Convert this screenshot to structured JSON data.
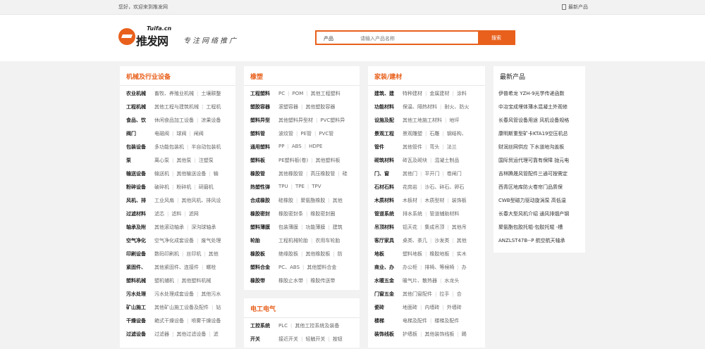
{
  "topbar": {
    "welcome": "您好，欢迎来到推发网",
    "latest": "最新产品"
  },
  "header": {
    "logo_en": "Tuifa.cn",
    "logo_cn": "推发网",
    "slogan": "专注网络推广",
    "search_category": "产品",
    "search_placeholder": "请输入产品名称",
    "search_button": "搜索"
  },
  "panels": [
    {
      "title": "机械及行业设备",
      "rows": [
        {
          "h": "农业机械",
          "s": [
            "畜牧、养殖业机械",
            "土壤耕整"
          ]
        },
        {
          "h": "工程机械",
          "s": [
            "其他工程与建筑机械",
            "工程机"
          ]
        },
        {
          "h": "食品、饮",
          "s": [
            "休闲食品加工设备",
            "凉果设备"
          ]
        },
        {
          "h": "阀门",
          "s": [
            "电磁阀",
            "球阀",
            "闸阀"
          ]
        },
        {
          "h": "包装设备",
          "s": [
            "多功能包装机",
            "半自动包装机"
          ]
        },
        {
          "h": "泵",
          "s": [
            "离心泵",
            "其他泵",
            "注塑泵"
          ]
        },
        {
          "h": "输送设备",
          "s": [
            "输送机",
            "其他输送设备",
            "输"
          ]
        },
        {
          "h": "粉碎设备",
          "s": [
            "破碎机",
            "粉碎机",
            "研磨机"
          ]
        },
        {
          "h": "风机、排",
          "s": [
            "工业风扇",
            "其他风机、排风设"
          ]
        },
        {
          "h": "过滤材料",
          "s": [
            "滤芯",
            "滤料",
            "滤网"
          ]
        },
        {
          "h": "轴承及附",
          "s": [
            "其他滚动轴承",
            "深沟球轴承"
          ]
        },
        {
          "h": "空气净化",
          "s": [
            "空气净化成套设备",
            "废气处理"
          ]
        },
        {
          "h": "印刷设备",
          "s": [
            "数码印刷机",
            "丝印机",
            "其他"
          ]
        },
        {
          "h": "紧固件、",
          "s": [
            "其他紧固件、连接件",
            "螺栓"
          ]
        },
        {
          "h": "塑料机械",
          "s": [
            "塑机辅机",
            "其他塑料机械"
          ]
        },
        {
          "h": "污水处理",
          "s": [
            "污水处理成套设备",
            "其他污水"
          ]
        },
        {
          "h": "矿山施工",
          "s": [
            "其他矿山施工设备及配件",
            "钻"
          ]
        },
        {
          "h": "干燥设备",
          "s": [
            "箱式干燥设备",
            "喷雾干燥设备"
          ]
        },
        {
          "h": "过滤设备",
          "s": [
            "过滤器",
            "其他过滤设备",
            "滤"
          ]
        }
      ]
    },
    {
      "title": "橡塑",
      "rows": [
        {
          "h": "工程塑料",
          "s": [
            "PC",
            "POM",
            "其他工程塑料"
          ]
        },
        {
          "h": "塑胶容器",
          "s": [
            "滚塑容器",
            "其他塑胶容器"
          ]
        },
        {
          "h": "塑料异型",
          "s": [
            "其他塑料异型材",
            "PVC塑料异"
          ]
        },
        {
          "h": "塑料管",
          "s": [
            "波纹管",
            "PE管",
            "PVC管"
          ]
        },
        {
          "h": "通用塑料",
          "s": [
            "PP",
            "ABS",
            "HDPE"
          ]
        },
        {
          "h": "塑料板",
          "s": [
            "PE塑料板(卷)",
            "其他塑料板"
          ]
        },
        {
          "h": "橡胶管",
          "s": [
            "其他橡胶管",
            "高压橡胶管",
            "硅"
          ]
        },
        {
          "h": "热塑性弹",
          "s": [
            "TPU",
            "TPE",
            "TPV"
          ]
        },
        {
          "h": "合成橡胶",
          "s": [
            "硅橡胶",
            "聚氨酯橡胶",
            "其他"
          ]
        },
        {
          "h": "橡胶密封",
          "s": [
            "橡胶密封条",
            "橡胶密封圈"
          ]
        },
        {
          "h": "塑料薄膜",
          "s": [
            "包装薄膜",
            "功能薄膜",
            "建筑"
          ]
        },
        {
          "h": "轮胎",
          "s": [
            "工程机械轮胎",
            "农用车轮胎"
          ]
        },
        {
          "h": "橡胶板",
          "s": [
            "绝缘胶板",
            "其他橡胶板",
            "防"
          ]
        },
        {
          "h": "塑料合金",
          "s": [
            "PC、ABS",
            "其他塑料合金"
          ]
        },
        {
          "h": "橡胶带",
          "s": [
            "橡胶止水带",
            "橡胶传送带"
          ]
        }
      ]
    },
    {
      "title": "电工电气",
      "rows": [
        {
          "h": "工控系统",
          "s": [
            "PLC",
            "其他工控系统及装备"
          ]
        },
        {
          "h": "开关",
          "s": [
            "接近开关",
            "轻触开关",
            "按钮"
          ]
        }
      ]
    },
    {
      "title": "家装/建材",
      "rows": [
        {
          "h": "建筑、建",
          "s": [
            "特种建材",
            "金属建材",
            "涂料"
          ]
        },
        {
          "h": "功能材料",
          "s": [
            "保温、隔热材料",
            "耐火、防火"
          ]
        },
        {
          "h": "设施及配",
          "s": [
            "其他工地施工材料",
            "地坪"
          ]
        },
        {
          "h": "景观工程",
          "s": [
            "景观雕塑",
            "石雕",
            "钢结构、"
          ]
        },
        {
          "h": "管件",
          "s": [
            "其他管件",
            "弯头",
            "法兰"
          ]
        },
        {
          "h": "砌筑材料",
          "s": [
            "砖瓦及砌块",
            "混凝土制品"
          ]
        },
        {
          "h": "门、窗",
          "s": [
            "其他门",
            "平开门",
            "卷闸门"
          ]
        },
        {
          "h": "石材石料",
          "s": [
            "花岗岩",
            "沙石、碎石、卵石"
          ]
        },
        {
          "h": "木质材料",
          "s": [
            "木板材",
            "木质型材",
            "装饰板"
          ]
        },
        {
          "h": "管道系统",
          "s": [
            "排水系统",
            "管道辅助材料"
          ]
        },
        {
          "h": "吊顶材料",
          "s": [
            "铝天花",
            "集成吊顶",
            "其他吊"
          ]
        },
        {
          "h": "客厅家具",
          "s": [
            "桌类、茶几",
            "沙发类",
            "其他"
          ]
        },
        {
          "h": "地板",
          "s": [
            "塑料地板",
            "橡胶地板",
            "实木"
          ]
        },
        {
          "h": "商业、办",
          "s": [
            "办公柜",
            "排椅、等候椅",
            "办"
          ]
        },
        {
          "h": "水暖五金",
          "s": [
            "暖气片、散热器",
            "水龙头"
          ]
        },
        {
          "h": "门窗五金",
          "s": [
            "其他门窗配件",
            "拉手",
            "合"
          ]
        },
        {
          "h": "瓷砖",
          "s": [
            "地面砖",
            "内墙砖",
            "外墙砖"
          ]
        },
        {
          "h": "楼梯",
          "s": [
            "电梯及配件",
            "楼梯及配件"
          ]
        },
        {
          "h": "装饰线板",
          "s": [
            "护墙板",
            "其他装饰线板",
            "踢"
          ]
        }
      ]
    },
    {
      "title": "最新产品",
      "news": [
        "伊普希龙 YZH-9光学传递函数",
        "中冶宝成埋体薄水混凝土外观修",
        "长春风管设备用途 风机设备规格",
        "康明斯重型矿卡KTA19空压机总",
        "财润丝网供应 下水道地沟盖板",
        "国际贸运代理可靠有保障 拢元电",
        "吉林腾晟风管配件三通可按需定",
        "西青区地库防火卷帘门品质保",
        "CWB型磁力驱动旋涡泵 高低温",
        "长春大型风机介绍 通风排烟产钢",
        "聚氨酯包胶托辊-包胶托辊 -槽",
        "ANZLST47B--P 航空航天轴承"
      ]
    }
  ]
}
